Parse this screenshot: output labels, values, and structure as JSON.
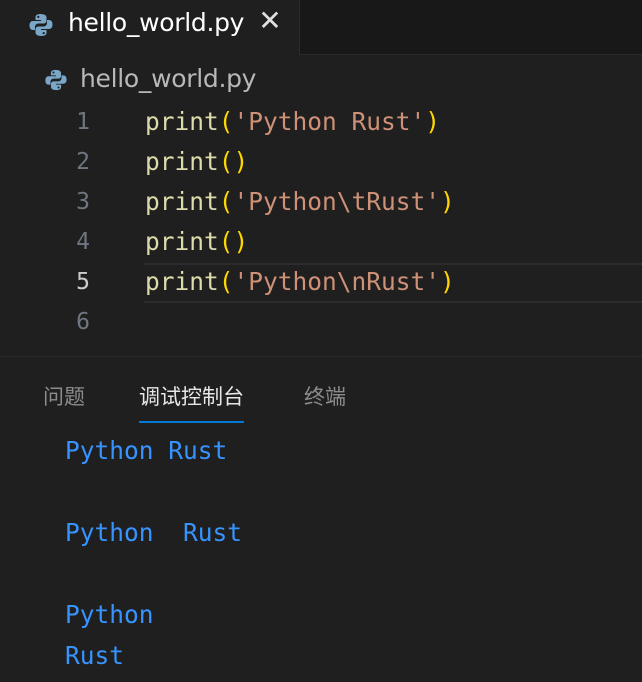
{
  "tab": {
    "title": "hello_world.py",
    "close_glyph": "✕",
    "icon": "python-icon"
  },
  "breadcrumb": {
    "file": "hello_world.py",
    "icon": "python-icon"
  },
  "editor": {
    "current_line": 5,
    "lines": [
      {
        "number": "1",
        "fn": "print",
        "open": "(",
        "str": "'Python Rust'",
        "close": ")"
      },
      {
        "number": "2",
        "fn": "print",
        "open": "(",
        "str": "",
        "close": ")"
      },
      {
        "number": "3",
        "fn": "print",
        "open": "(",
        "str": "'Python\\tRust'",
        "close": ")"
      },
      {
        "number": "4",
        "fn": "print",
        "open": "(",
        "str": "",
        "close": ")"
      },
      {
        "number": "5",
        "fn": "print",
        "open": "(",
        "str": "'Python\\nRust'",
        "close": ")"
      },
      {
        "number": "6",
        "fn": "",
        "open": "",
        "str": "",
        "close": ""
      }
    ]
  },
  "panel": {
    "tabs": [
      {
        "label": "问题",
        "active": false
      },
      {
        "label": "调试控制台",
        "active": true
      },
      {
        "label": "终端",
        "active": false
      }
    ],
    "output": [
      "Python Rust",
      "",
      "Python  Rust",
      "",
      "Python",
      "Rust"
    ]
  },
  "colors": {
    "background": "#1f1f1f",
    "function": "#dcdcaa",
    "bracket": "#ffd700",
    "string": "#ce9178",
    "output_text": "#3794ff",
    "active_tab_underline": "#0078d4"
  }
}
